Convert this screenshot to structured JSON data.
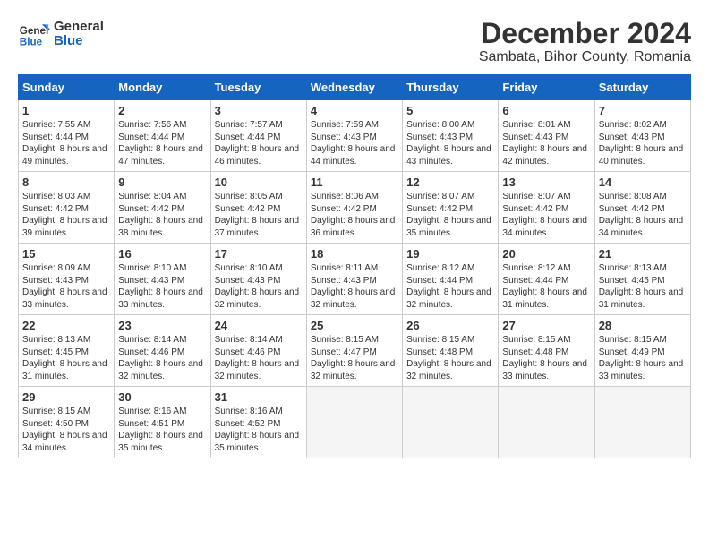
{
  "header": {
    "logo_line1": "General",
    "logo_line2": "Blue",
    "title": "December 2024",
    "subtitle": "Sambata, Bihor County, Romania"
  },
  "calendar": {
    "columns": [
      "Sunday",
      "Monday",
      "Tuesday",
      "Wednesday",
      "Thursday",
      "Friday",
      "Saturday"
    ],
    "weeks": [
      [
        {
          "day": "1",
          "info": "Sunrise: 7:55 AM\nSunset: 4:44 PM\nDaylight: 8 hours and 49 minutes."
        },
        {
          "day": "2",
          "info": "Sunrise: 7:56 AM\nSunset: 4:44 PM\nDaylight: 8 hours and 47 minutes."
        },
        {
          "day": "3",
          "info": "Sunrise: 7:57 AM\nSunset: 4:44 PM\nDaylight: 8 hours and 46 minutes."
        },
        {
          "day": "4",
          "info": "Sunrise: 7:59 AM\nSunset: 4:43 PM\nDaylight: 8 hours and 44 minutes."
        },
        {
          "day": "5",
          "info": "Sunrise: 8:00 AM\nSunset: 4:43 PM\nDaylight: 8 hours and 43 minutes."
        },
        {
          "day": "6",
          "info": "Sunrise: 8:01 AM\nSunset: 4:43 PM\nDaylight: 8 hours and 42 minutes."
        },
        {
          "day": "7",
          "info": "Sunrise: 8:02 AM\nSunset: 4:43 PM\nDaylight: 8 hours and 40 minutes."
        }
      ],
      [
        {
          "day": "8",
          "info": "Sunrise: 8:03 AM\nSunset: 4:42 PM\nDaylight: 8 hours and 39 minutes."
        },
        {
          "day": "9",
          "info": "Sunrise: 8:04 AM\nSunset: 4:42 PM\nDaylight: 8 hours and 38 minutes."
        },
        {
          "day": "10",
          "info": "Sunrise: 8:05 AM\nSunset: 4:42 PM\nDaylight: 8 hours and 37 minutes."
        },
        {
          "day": "11",
          "info": "Sunrise: 8:06 AM\nSunset: 4:42 PM\nDaylight: 8 hours and 36 minutes."
        },
        {
          "day": "12",
          "info": "Sunrise: 8:07 AM\nSunset: 4:42 PM\nDaylight: 8 hours and 35 minutes."
        },
        {
          "day": "13",
          "info": "Sunrise: 8:07 AM\nSunset: 4:42 PM\nDaylight: 8 hours and 34 minutes."
        },
        {
          "day": "14",
          "info": "Sunrise: 8:08 AM\nSunset: 4:42 PM\nDaylight: 8 hours and 34 minutes."
        }
      ],
      [
        {
          "day": "15",
          "info": "Sunrise: 8:09 AM\nSunset: 4:43 PM\nDaylight: 8 hours and 33 minutes."
        },
        {
          "day": "16",
          "info": "Sunrise: 8:10 AM\nSunset: 4:43 PM\nDaylight: 8 hours and 33 minutes."
        },
        {
          "day": "17",
          "info": "Sunrise: 8:10 AM\nSunset: 4:43 PM\nDaylight: 8 hours and 32 minutes."
        },
        {
          "day": "18",
          "info": "Sunrise: 8:11 AM\nSunset: 4:43 PM\nDaylight: 8 hours and 32 minutes."
        },
        {
          "day": "19",
          "info": "Sunrise: 8:12 AM\nSunset: 4:44 PM\nDaylight: 8 hours and 32 minutes."
        },
        {
          "day": "20",
          "info": "Sunrise: 8:12 AM\nSunset: 4:44 PM\nDaylight: 8 hours and 31 minutes."
        },
        {
          "day": "21",
          "info": "Sunrise: 8:13 AM\nSunset: 4:45 PM\nDaylight: 8 hours and 31 minutes."
        }
      ],
      [
        {
          "day": "22",
          "info": "Sunrise: 8:13 AM\nSunset: 4:45 PM\nDaylight: 8 hours and 31 minutes."
        },
        {
          "day": "23",
          "info": "Sunrise: 8:14 AM\nSunset: 4:46 PM\nDaylight: 8 hours and 32 minutes."
        },
        {
          "day": "24",
          "info": "Sunrise: 8:14 AM\nSunset: 4:46 PM\nDaylight: 8 hours and 32 minutes."
        },
        {
          "day": "25",
          "info": "Sunrise: 8:15 AM\nSunset: 4:47 PM\nDaylight: 8 hours and 32 minutes."
        },
        {
          "day": "26",
          "info": "Sunrise: 8:15 AM\nSunset: 4:48 PM\nDaylight: 8 hours and 32 minutes."
        },
        {
          "day": "27",
          "info": "Sunrise: 8:15 AM\nSunset: 4:48 PM\nDaylight: 8 hours and 33 minutes."
        },
        {
          "day": "28",
          "info": "Sunrise: 8:15 AM\nSunset: 4:49 PM\nDaylight: 8 hours and 33 minutes."
        }
      ],
      [
        {
          "day": "29",
          "info": "Sunrise: 8:15 AM\nSunset: 4:50 PM\nDaylight: 8 hours and 34 minutes."
        },
        {
          "day": "30",
          "info": "Sunrise: 8:16 AM\nSunset: 4:51 PM\nDaylight: 8 hours and 35 minutes."
        },
        {
          "day": "31",
          "info": "Sunrise: 8:16 AM\nSunset: 4:52 PM\nDaylight: 8 hours and 35 minutes."
        },
        {
          "day": "",
          "info": ""
        },
        {
          "day": "",
          "info": ""
        },
        {
          "day": "",
          "info": ""
        },
        {
          "day": "",
          "info": ""
        }
      ]
    ]
  }
}
